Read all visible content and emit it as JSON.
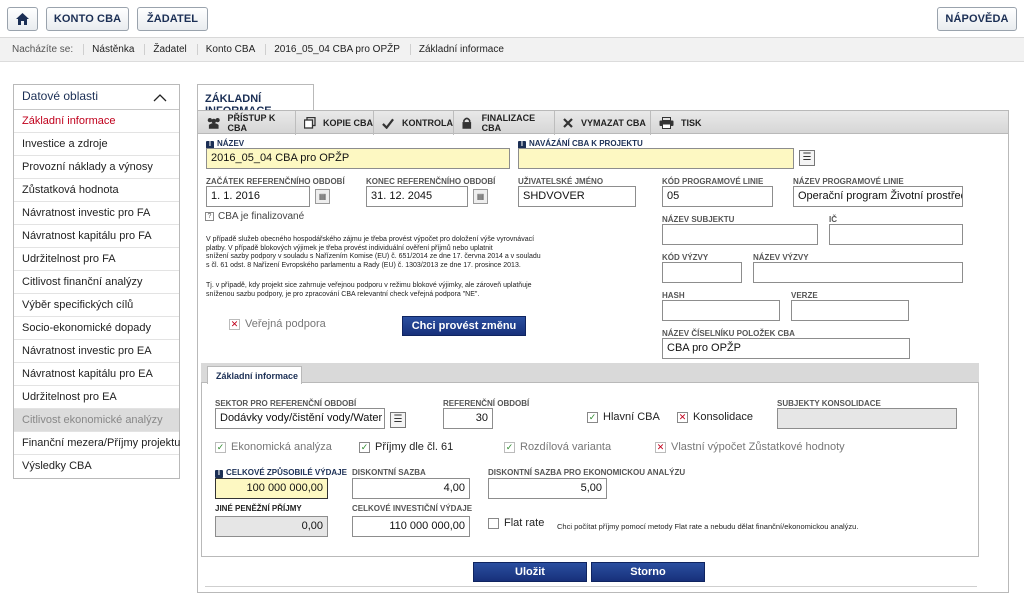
{
  "topbar": {
    "home_icon": "home-icon",
    "konto_label": "KONTO CBA",
    "zadatel_label": "ŽADATEL",
    "napoveda_label": "NÁPOVĚDA"
  },
  "breadcrumb": {
    "prefix": "Nacházíte se:",
    "items": [
      "Nástěnka",
      "Žadatel",
      "Konto CBA",
      "2016_05_04 CBA pro OPŽP",
      "Základní informace"
    ]
  },
  "sidebar": {
    "title": "Datové oblasti",
    "items": [
      {
        "label": "Základní informace"
      },
      {
        "label": "Investice a zdroje"
      },
      {
        "label": "Provozní náklady a výnosy"
      },
      {
        "label": "Zůstatková hodnota"
      },
      {
        "label": "Návratnost investic pro FA"
      },
      {
        "label": "Návratnost kapitálu pro FA"
      },
      {
        "label": "Udržitelnost pro FA"
      },
      {
        "label": "Citlivost finanční analýzy"
      },
      {
        "label": "Výběr specifických cílů"
      },
      {
        "label": "Socio-ekonomické dopady"
      },
      {
        "label": "Návratnost investic pro EA"
      },
      {
        "label": "Návratnost kapitálu pro EA"
      },
      {
        "label": "Udržitelnost pro EA"
      },
      {
        "label": "Citlivost ekonomické analýzy"
      },
      {
        "label": "Finanční mezera/Příjmy projektu"
      },
      {
        "label": "Výsledky CBA"
      }
    ]
  },
  "main_tab": "ZÁKLADNÍ INFORMACE",
  "toolbar": {
    "pristup": "PŘÍSTUP K CBA",
    "kopie": "KOPIE CBA",
    "kontrola": "KONTROLA",
    "finalizace": "FINALIZACE CBA",
    "vymazat": "VYMAZAT CBA",
    "tisk": "TISK"
  },
  "form": {
    "nazev_label": "NÁZEV",
    "nazev_value": "2016_05_04 CBA pro OPŽP",
    "navazani_label": "NAVÁZÁNÍ CBA K PROJEKTU",
    "navazani_value": "",
    "zacatek_label": "ZAČÁTEK REFERENČNÍHO OBDOBÍ",
    "zacatek_value": "1. 1. 2016",
    "konec_label": "KONEC REFERENČNÍHO OBDOBÍ",
    "konec_value": "31. 12. 2045",
    "uzivatel_label": "UŽIVATELSKÉ JMÉNO",
    "uzivatel_value": "SHDVOVER",
    "kod_linie_label": "KÓD PROGRAMOVÉ LINIE",
    "kod_linie_value": "05",
    "nazev_linie_label": "NÁZEV PROGRAMOVÉ LINIE",
    "nazev_linie_value": "Operační program Životní prostředí",
    "finalizovane_label": "CBA je finalizované",
    "nazev_subjektu_label": "NÁZEV SUBJEKTU",
    "nazev_subjektu_value": "",
    "ic_label": "IČ",
    "ic_value": "",
    "kod_vyzvy_label": "KÓD VÝZVY",
    "kod_vyzvy_value": "",
    "nazev_vyzvy_label": "NÁZEV VÝZVY",
    "nazev_vyzvy_value": "",
    "hash_label": "HASH",
    "hash_value": "",
    "verze_label": "VERZE",
    "verze_value": "",
    "ciselnik_label": "NÁZEV ČÍSELNÍKU POLOŽEK CBA",
    "ciselnik_value": "CBA pro OPŽP",
    "note1": [
      "V případě služeb obecného hospodářského zájmu je třeba provést výpočet pro doložení výše vyrovnávací",
      "platby. V případě blokových výjimek je třeba provést individuální ověření příjmů nebo uplatnit",
      "snížení sazby podpory v souladu s Nařízením Komise (EU) č. 651/2014 ze dne 17. června 2014 a v souladu",
      "s čl. 61 odst. 8 Nařízení Evropského parlamentu a Rady (EU) č. 1303/2013 ze dne 17. prosince 2013."
    ],
    "note2": [
      "Tj. v případě, kdy projekt sice zahrnuje veřejnou podporu v režimu blokové výjimky, ale zároveň uplatňuje",
      "sníženou sazbu podpory, je pro zpracování CBA relevantní check veřejná podpora \"NE\"."
    ],
    "verejna_podpora_label": "Veřejná podpora",
    "zmena_button": "Chci provést změnu"
  },
  "sub": {
    "tab_label": "Základní informace",
    "sektor_label": "SEKTOR PRO REFERENČNÍ OBDOBÍ",
    "sektor_value": "Dodávky vody/čistění vody/Water su...",
    "ref_obdobi_label": "REFERENČNÍ OBDOBÍ",
    "ref_obdobi_value": "30",
    "hlavni_cba_label": "Hlavní CBA",
    "konsolidace_label": "Konsolidace",
    "subjekty_label": "SUBJEKTY KONSOLIDACE",
    "subjekty_value": "",
    "ekon_analyza_label": "Ekonomická analýza",
    "prijmy_label": "Příjmy dle čl. 61",
    "rozdilova_label": "Rozdílová varianta",
    "vlastni_label": "Vlastní výpočet Zůstatkové hodnoty",
    "celkove_label": "CELKOVÉ ZPŮSOBILÉ VÝDAJE",
    "celkove_value": "100 000 000,00",
    "diskontni_label": "DISKONTNÍ SAZBA",
    "diskontni_value": "4,00",
    "diskontni_ea_label": "DISKONTNÍ SAZBA PRO EKONOMICKOU ANALÝZU",
    "diskontni_ea_value": "5,00",
    "jine_label": "JINÉ PENĚŽNÍ PŘÍJMY",
    "jine_value": "0,00",
    "celkove_inv_label": "CELKOVÉ INVESTIČNÍ VÝDAJE",
    "celkove_inv_value": "110 000 000,00",
    "flat_rate_label": "Flat rate",
    "flat_rate_note": "Chci počítat příjmy pomocí metody Flat rate a nebudu dělat finanční/ekonomickou analýzu."
  },
  "actions": {
    "ulozit": "Uložit",
    "storno": "Storno"
  }
}
